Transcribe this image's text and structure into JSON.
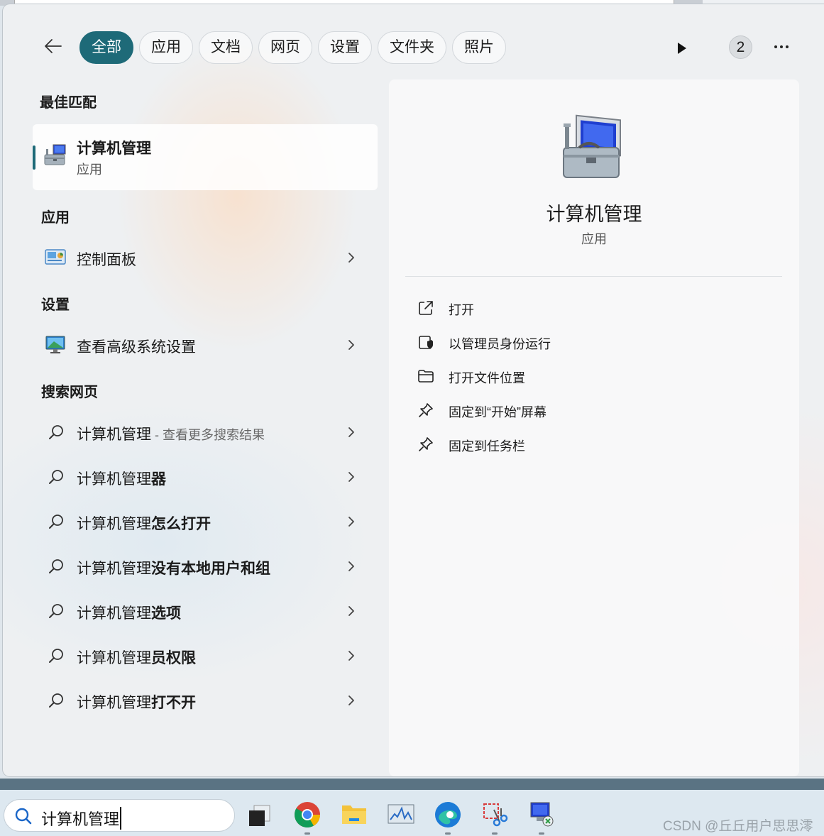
{
  "filters": {
    "items": [
      "全部",
      "应用",
      "文档",
      "网页",
      "设置",
      "文件夹",
      "照片"
    ],
    "active_index": 0,
    "count_badge": "2"
  },
  "best_match": {
    "heading": "最佳匹配",
    "title": "计算机管理",
    "subtitle": "应用"
  },
  "apps": {
    "heading": "应用",
    "items": [
      {
        "label": "控制面板"
      }
    ]
  },
  "settings": {
    "heading": "设置",
    "items": [
      {
        "label": "查看高级系统设置"
      }
    ]
  },
  "web": {
    "heading": "搜索网页",
    "first": {
      "query": "计算机管理",
      "hint": " - 查看更多搜索结果"
    },
    "suggestions": [
      {
        "prefix": "计算机管理",
        "bold": "器"
      },
      {
        "prefix": "计算机管理",
        "bold": "怎么打开"
      },
      {
        "prefix": "计算机管理",
        "bold": "没有本地用户和组"
      },
      {
        "prefix": "计算机管理",
        "bold": "选项"
      },
      {
        "prefix": "计算机管理",
        "bold": "员权限"
      },
      {
        "prefix": "计算机管理",
        "bold": "打不开"
      }
    ]
  },
  "detail": {
    "title": "计算机管理",
    "subtitle": "应用",
    "actions": [
      {
        "label": "打开",
        "icon": "open-external-icon"
      },
      {
        "label": "以管理员身份运行",
        "icon": "shield-icon"
      },
      {
        "label": "打开文件位置",
        "icon": "folder-icon"
      },
      {
        "label": "固定到“开始”屏幕",
        "icon": "pin-icon"
      },
      {
        "label": "固定到任务栏",
        "icon": "pin-icon"
      }
    ]
  },
  "taskbar": {
    "search_value": "计算机管理",
    "apps": [
      "task-view-icon",
      "chrome-icon",
      "file-explorer-icon",
      "resource-monitor-icon",
      "edge-icon",
      "snipping-tool-icon",
      "remote-desktop-icon"
    ]
  },
  "watermark": "CSDN @丘丘用户思思澪",
  "colors": {
    "accent": "#1e6a78"
  }
}
